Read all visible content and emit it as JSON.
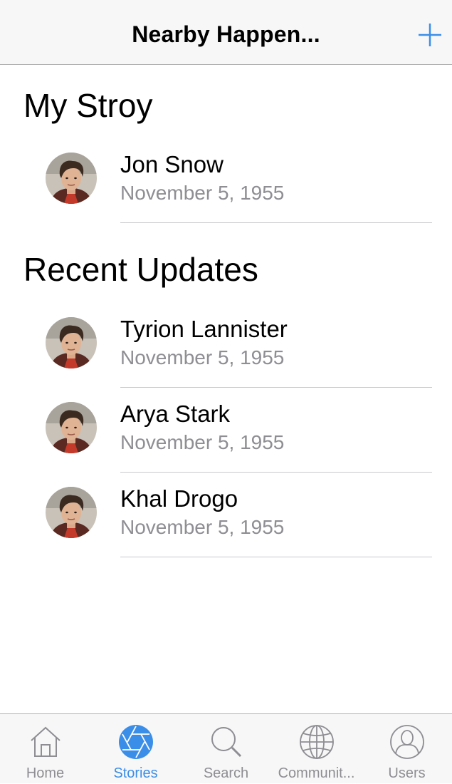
{
  "navbar": {
    "title": "Nearby Happen...",
    "add_icon": "plus-icon"
  },
  "colors": {
    "accent": "#3b8ee8",
    "secondary_text": "#8e8e93",
    "separator": "#c8c7cc"
  },
  "sections": {
    "my_story": {
      "title": "My Stroy",
      "items": [
        {
          "name": "Jon Snow",
          "date": "November 5, 1955"
        }
      ]
    },
    "recent": {
      "title": "Recent Updates",
      "items": [
        {
          "name": "Tyrion Lannister",
          "date": "November 5, 1955"
        },
        {
          "name": "Arya Stark",
          "date": "November 5, 1955"
        },
        {
          "name": "Khal Drogo",
          "date": "November 5, 1955"
        }
      ]
    }
  },
  "tabs": [
    {
      "label": "Home",
      "icon": "home-icon",
      "selected": false
    },
    {
      "label": "Stories",
      "icon": "aperture-icon",
      "selected": true
    },
    {
      "label": "Search",
      "icon": "search-icon",
      "selected": false
    },
    {
      "label": "Communit...",
      "icon": "globe-icon",
      "selected": false
    },
    {
      "label": "Users",
      "icon": "user-icon",
      "selected": false
    }
  ]
}
